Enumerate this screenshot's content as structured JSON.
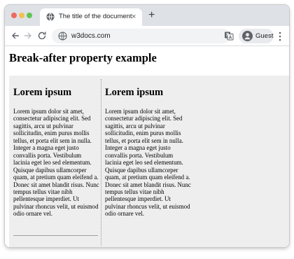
{
  "browser": {
    "tab_title": "The title of the document",
    "tab_close": "×",
    "new_tab": "+",
    "url": "w3docs.com",
    "profile_label": "Guest"
  },
  "page": {
    "title": "Break-after property example",
    "columns": [
      {
        "heading": "Lorem ipsum",
        "text": "Lorem ipsum dolor sit amet, consectetur adipiscing elit. Sed sagittis, arcu ut pulvinar sollicitudin, enim purus mollis tellus, et porta elit sem in nulla. Integer a magna eget justo convallis porta. Vestibulum lacinia eget leo sed elementum. Quisque dapibus ullamcorper quam, at pretium quam eleifend a. Donec sit amet blandit risus. Nunc tempus tellus vitae nibh pellentesque imperdiet. Ut pulvinar rhoncus velit, ut euismod odio ornare vel."
      },
      {
        "heading": "Lorem ipsum",
        "text": "Lorem ipsum dolor sit amet, consectetur adipiscing elit. Sed sagittis, arcu ut pulvinar sollicitudin, enim purus mollis tellus, et porta elit sem in nulla. Integer a magna eget justo convallis porta. Vestibulum lacinia eget leo sed elementum. Quisque dapibus ullamcorper quam, at pretium quam eleifend a. Donec sit amet blandit risus. Nunc tempus tellus vitae nibh pellentesque imperdiet. Ut pulvinar rhoncus velit, ut euismod odio ornare vel."
      }
    ]
  },
  "icons": {
    "close": "close-icon",
    "favicon": "globe-icon",
    "back": "arrow-left-icon",
    "forward": "arrow-right-icon",
    "reload": "reload-icon",
    "site_info": "globe-icon",
    "translate": "translate-icon",
    "profile": "avatar-icon",
    "menu": "more-vert-icon"
  },
  "colors": {
    "tabstrip": "#dee1e6",
    "omnibox": "#f1f3f4",
    "columns_bg": "#eeeeee",
    "traffic_red": "#ed6a5e",
    "traffic_yellow": "#f5bf4f",
    "traffic_green": "#61c554"
  }
}
